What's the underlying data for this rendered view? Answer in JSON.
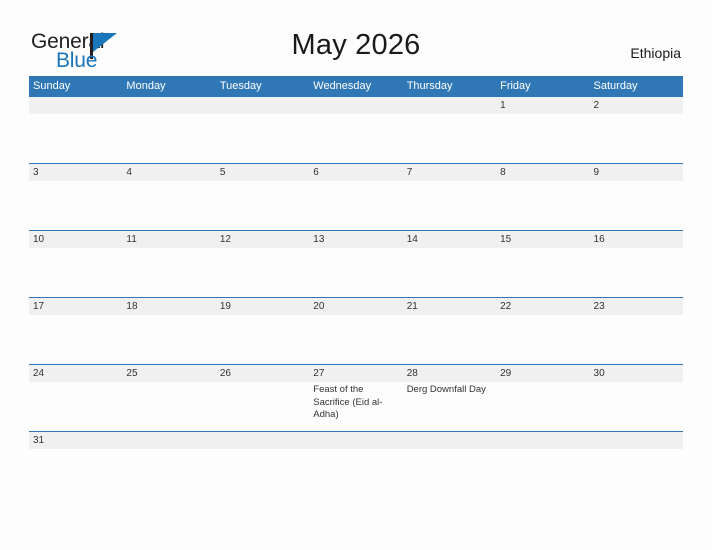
{
  "logo": {
    "word_one": "General",
    "word_two": "Blue",
    "icon": "flag-triangle-icon",
    "color_black": "#231f20",
    "color_blue": "#1b75bb"
  },
  "header": {
    "title": "May 2026",
    "country": "Ethiopia"
  },
  "theme": {
    "header_blue": "#3077b5",
    "row_border_blue": "#3077b5",
    "date_strip_gray": "#f0f0f0",
    "page_background": "#fdfdfd",
    "text_color": "#333333"
  },
  "calendar": {
    "month": "May",
    "year": 2026,
    "weekday_headers": [
      "Sunday",
      "Monday",
      "Tuesday",
      "Wednesday",
      "Thursday",
      "Friday",
      "Saturday"
    ],
    "weeks": [
      {
        "days": [
          {
            "num": "",
            "events": []
          },
          {
            "num": "",
            "events": []
          },
          {
            "num": "",
            "events": []
          },
          {
            "num": "",
            "events": []
          },
          {
            "num": "",
            "events": []
          },
          {
            "num": "1",
            "events": []
          },
          {
            "num": "2",
            "events": []
          }
        ]
      },
      {
        "days": [
          {
            "num": "3",
            "events": []
          },
          {
            "num": "4",
            "events": []
          },
          {
            "num": "5",
            "events": []
          },
          {
            "num": "6",
            "events": []
          },
          {
            "num": "7",
            "events": []
          },
          {
            "num": "8",
            "events": []
          },
          {
            "num": "9",
            "events": []
          }
        ]
      },
      {
        "days": [
          {
            "num": "10",
            "events": []
          },
          {
            "num": "11",
            "events": []
          },
          {
            "num": "12",
            "events": []
          },
          {
            "num": "13",
            "events": []
          },
          {
            "num": "14",
            "events": []
          },
          {
            "num": "15",
            "events": []
          },
          {
            "num": "16",
            "events": []
          }
        ]
      },
      {
        "days": [
          {
            "num": "17",
            "events": []
          },
          {
            "num": "18",
            "events": []
          },
          {
            "num": "19",
            "events": []
          },
          {
            "num": "20",
            "events": []
          },
          {
            "num": "21",
            "events": []
          },
          {
            "num": "22",
            "events": []
          },
          {
            "num": "23",
            "events": []
          }
        ]
      },
      {
        "days": [
          {
            "num": "24",
            "events": []
          },
          {
            "num": "25",
            "events": []
          },
          {
            "num": "26",
            "events": []
          },
          {
            "num": "27",
            "events": [
              "Feast of the Sacrifice (Eid al-Adha)"
            ]
          },
          {
            "num": "28",
            "events": [
              "Derg Downfall Day"
            ]
          },
          {
            "num": "29",
            "events": []
          },
          {
            "num": "30",
            "events": []
          }
        ]
      },
      {
        "days": [
          {
            "num": "31",
            "events": []
          },
          {
            "num": "",
            "events": []
          },
          {
            "num": "",
            "events": []
          },
          {
            "num": "",
            "events": []
          },
          {
            "num": "",
            "events": []
          },
          {
            "num": "",
            "events": []
          },
          {
            "num": "",
            "events": []
          }
        ]
      }
    ]
  }
}
